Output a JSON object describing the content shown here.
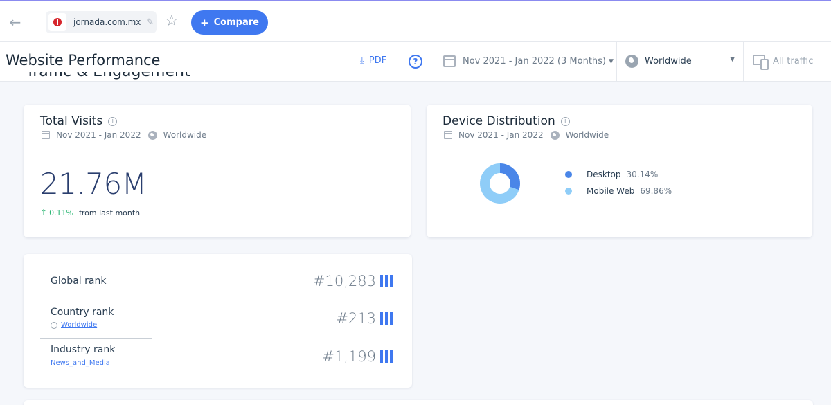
{
  "topbar": {
    "site_name": "jornada.com.mx",
    "compare_label": "Compare"
  },
  "header": {
    "title": "Website Performance",
    "pdf_label": "PDF",
    "help_symbol": "?",
    "date_range": "Nov 2021 - Jan 2022 (3 Months)",
    "region": "Worldwide",
    "traffic": "All traffic"
  },
  "section": {
    "title": "Traffic & Engagement"
  },
  "total_visits": {
    "title": "Total Visits",
    "date": "Nov 2021 - Jan 2022",
    "region": "Worldwide",
    "value": "21.76M",
    "change_arrow": "↑",
    "change_pct": "0.11%",
    "change_text": "from last month"
  },
  "device_distribution": {
    "title": "Device Distribution",
    "date": "Nov 2021 - Jan 2022",
    "region": "Worldwide",
    "colors": {
      "desktop": "#4a86e8",
      "mobile": "#8fcdf8"
    },
    "items": [
      {
        "label": "Desktop",
        "value": "30.14%",
        "share": 30.14
      },
      {
        "label": "Mobile Web",
        "value": "69.86%",
        "share": 69.86
      }
    ]
  },
  "ranks": {
    "global": {
      "label": "Global rank",
      "value": "#10,283"
    },
    "country": {
      "label": "Country rank",
      "sub": "Worldwide",
      "value": "#213"
    },
    "industry": {
      "label": "Industry rank",
      "sub": "News_and_Media",
      "value": "#1,199"
    }
  },
  "colors": {
    "accent": "#3f78f0",
    "positive": "#2bb673"
  }
}
